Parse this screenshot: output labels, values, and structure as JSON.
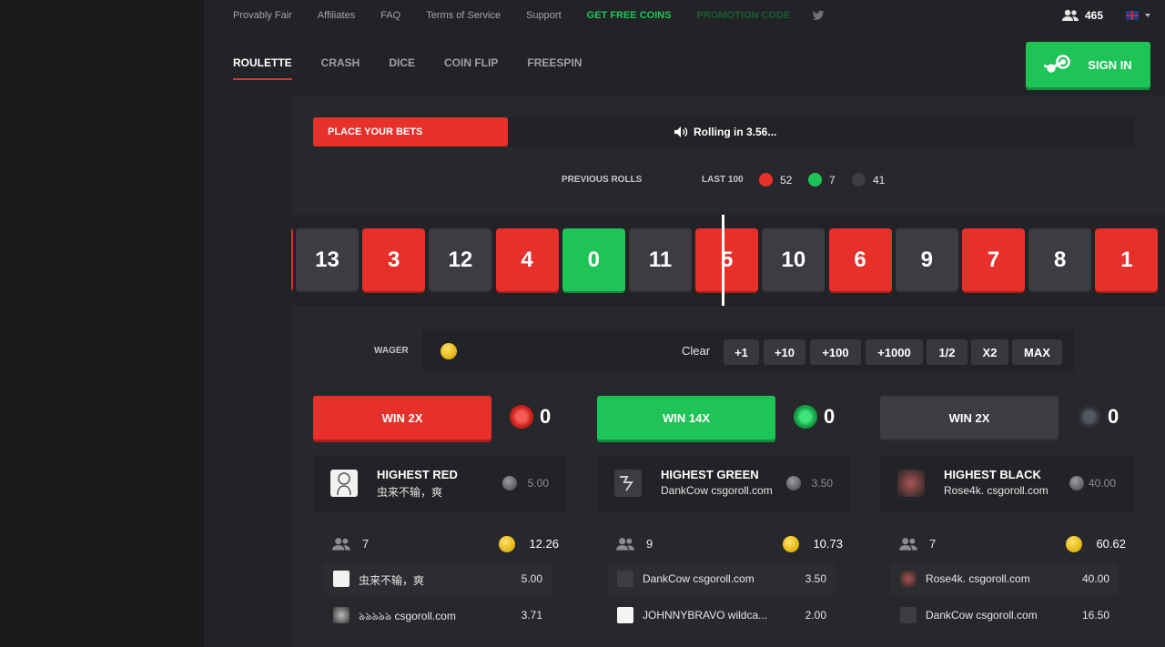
{
  "top_nav": {
    "links": [
      "Provably Fair",
      "Affiliates",
      "FAQ",
      "Terms of Service",
      "Support"
    ],
    "free_coins": "GET FREE COINS",
    "promo": "PROMOTION CODE",
    "online_count": "465",
    "twitter_icon": "twitter-icon",
    "language_flag": "uk-flag-icon"
  },
  "game_tabs": [
    "ROULETTE",
    "CRASH",
    "DICE",
    "COIN FLIP",
    "FREESPIN"
  ],
  "signin_label": "SIGN IN",
  "status": {
    "place_bets": "PLACE YOUR BETS",
    "rolling_text": "Rolling in 3.56...",
    "progress_fraction": 0.24
  },
  "previous": {
    "label": "PREVIOUS ROLLS",
    "last_label": "LAST 100",
    "red": "52",
    "green": "7",
    "black": "41"
  },
  "roll_strip": [
    {
      "n": "13",
      "c": "black"
    },
    {
      "n": "3",
      "c": "red"
    },
    {
      "n": "12",
      "c": "black"
    },
    {
      "n": "4",
      "c": "red"
    },
    {
      "n": "0",
      "c": "green"
    },
    {
      "n": "11",
      "c": "black"
    },
    {
      "n": "5",
      "c": "red"
    },
    {
      "n": "10",
      "c": "black"
    },
    {
      "n": "6",
      "c": "red"
    },
    {
      "n": "9",
      "c": "black"
    },
    {
      "n": "7",
      "c": "red"
    },
    {
      "n": "8",
      "c": "black"
    },
    {
      "n": "1",
      "c": "red"
    }
  ],
  "wager": {
    "label": "WAGER",
    "clear": "Clear",
    "buttons": [
      "+1",
      "+10",
      "+100",
      "+1000",
      "1/2",
      "X2",
      "MAX"
    ]
  },
  "columns": [
    {
      "bet_label": "WIN 2X",
      "bet_total": "0",
      "highest_title": "HIGHEST RED",
      "highest_name": "虫来不输，爽",
      "highest_amount": "5.00",
      "players_count": "7",
      "coins_total": "12.26",
      "players": [
        {
          "name": "虫来不输，爽",
          "amount": "5.00"
        },
        {
          "name": "ঌঌঌঌঌ csgoroll.com",
          "amount": "3.71"
        }
      ]
    },
    {
      "bet_label": "WIN 14X",
      "bet_total": "0",
      "highest_title": "HIGHEST GREEN",
      "highest_name": "DankCow csgoroll.com",
      "highest_amount": "3.50",
      "players_count": "9",
      "coins_total": "10.73",
      "players": [
        {
          "name": "DankCow csgoroll.com",
          "amount": "3.50"
        },
        {
          "name": "JOHNNYBRAVO wildca...",
          "amount": "2.00"
        }
      ]
    },
    {
      "bet_label": "WIN 2X",
      "bet_total": "0",
      "highest_title": "HIGHEST BLACK",
      "highest_name": "Rose4k. csgoroll.com",
      "highest_amount": "40.00",
      "players_count": "7",
      "coins_total": "60.62",
      "players": [
        {
          "name": "Rose4k. csgoroll.com",
          "amount": "40.00"
        },
        {
          "name": "DankCow csgoroll.com",
          "amount": "16.50"
        }
      ]
    }
  ],
  "colors": {
    "red": "#e8302a",
    "green": "#1ec456",
    "black": "#3b3d42"
  }
}
